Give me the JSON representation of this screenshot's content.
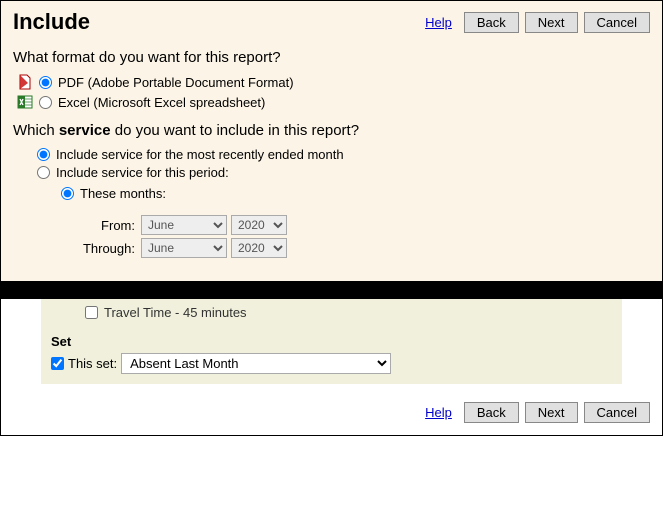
{
  "header": {
    "title": "Include",
    "help": "Help",
    "back": "Back",
    "next": "Next",
    "cancel": "Cancel"
  },
  "format": {
    "question": "What format do you want for this report?",
    "pdf_label": "PDF (Adobe Portable Document Format)",
    "excel_label": "Excel (Microsoft Excel spreadsheet)"
  },
  "service": {
    "question_pre": "Which ",
    "question_bold": "service",
    "question_post": " do you want to include in this report?",
    "opt_recent": "Include service for the most recently ended month",
    "opt_period": "Include service for this period:",
    "these_months": "These months:",
    "from_label": "From:",
    "through_label": "Through:",
    "from_month": "June",
    "from_year": "2020",
    "through_month": "June",
    "through_year": "2020"
  },
  "bottom": {
    "travel_label": "Travel Time - 45 minutes",
    "set_heading": "Set",
    "this_set_label": "This set:",
    "this_set_value": "Absent Last Month"
  },
  "footer": {
    "help": "Help",
    "back": "Back",
    "next": "Next",
    "cancel": "Cancel"
  }
}
